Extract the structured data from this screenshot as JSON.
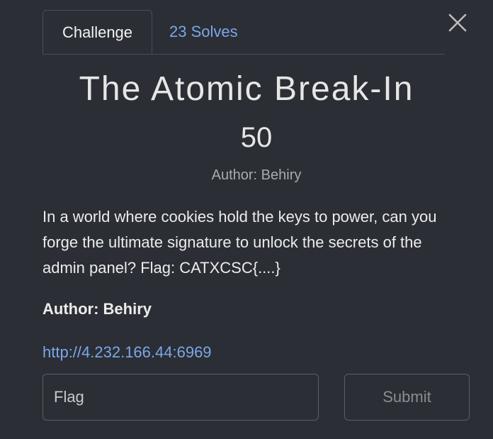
{
  "modal": {
    "close_icon": "close-icon"
  },
  "tabs": {
    "challenge_label": "Challenge",
    "solves_label": "23 Solves"
  },
  "challenge": {
    "title": "The Atomic Break-In",
    "points": "50",
    "author_line": "Author: Behiry",
    "description": "In a world where cookies hold the keys to power, can you forge the ultimate signature to unlock the secrets of the admin panel? Flag: CATXCSC{....}",
    "author_bold": "Author: Behiry",
    "link": "http://4.232.166.44:6969"
  },
  "form": {
    "flag_placeholder": "Flag",
    "flag_value": "",
    "submit_label": "Submit"
  },
  "colors": {
    "background": "#2b2e34",
    "link": "#7aa7ea",
    "border": "#5a5e66"
  }
}
